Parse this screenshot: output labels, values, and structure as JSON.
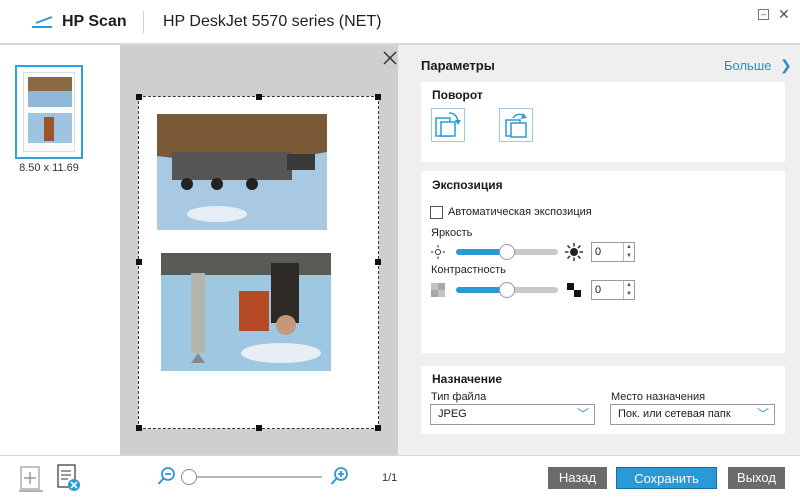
{
  "window": {
    "app_name": "HP Scan",
    "device_name": "HP DeskJet 5570 series (NET)",
    "minimize_symbol": "–",
    "close_symbol": "✕"
  },
  "thumbnails": {
    "items": [
      {
        "size_label": "8.50  x  11.69"
      }
    ]
  },
  "settings": {
    "title": "Параметры",
    "more_label": "Больше",
    "more_chevron": "❯",
    "rotation": {
      "title": "Поворот",
      "buttons": [
        "rotate-left-icon",
        "rotate-right-icon"
      ]
    },
    "exposure": {
      "title": "Экспозиция",
      "auto_label": "Автоматическая экспозиция",
      "auto_checked": false,
      "brightness_label": "Яркость",
      "brightness_value": "0",
      "brightness_level": 0.5,
      "contrast_label": "Контрастность",
      "contrast_value": "0",
      "contrast_level": 0.5,
      "spin_up": "▲",
      "spin_down": "▼"
    },
    "destination": {
      "title": "Назначение",
      "file_type_label": "Тип файла",
      "file_type_value": "JPEG",
      "target_label": "Место назначения",
      "target_value": "Пок. или сетевая папк",
      "arrow": "﹀"
    }
  },
  "toolbar": {
    "page_count": "1/1",
    "zoom_level": 0.0,
    "back_label": "Назад",
    "save_label": "Сохранить",
    "exit_label": "Выход"
  },
  "colors": {
    "accent": "#2a9ad6",
    "link": "#2a8fc7",
    "gray_button": "#6b6b6b"
  }
}
